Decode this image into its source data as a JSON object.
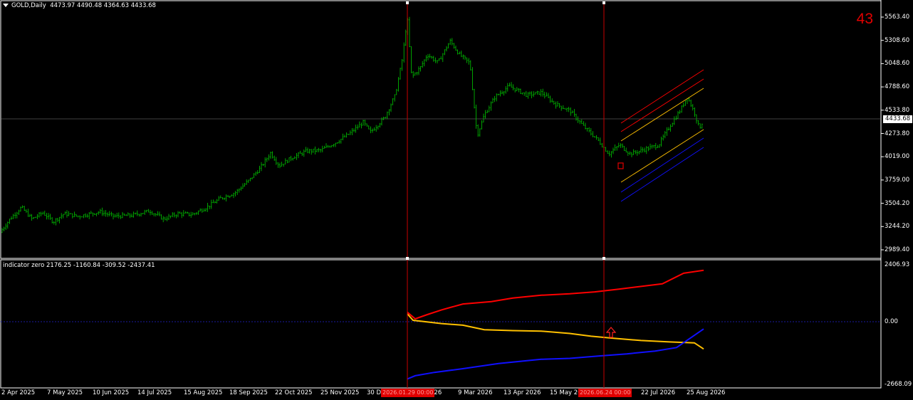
{
  "header": {
    "symbol": "GOLD,Daily",
    "ohlc": "4473.97 4490.48 4364.63 4433.68",
    "counter": "43"
  },
  "current_price": "4433.68",
  "price_axis": [
    "5563.40",
    "5308.60",
    "5048.60",
    "4788.60",
    "4533.80",
    "4273.80",
    "4019.00",
    "3759.00",
    "3504.20",
    "3244.20",
    "2989.40"
  ],
  "indicator": {
    "title": "indicator zero 2176.25 -1160.84 -309.52 -2437.41",
    "axis": [
      "2406.93",
      "0.00",
      "-2668.09"
    ]
  },
  "time_axis": [
    "2 Apr 2025",
    "7 May 2025",
    "10 Jun 2025",
    "14 Jul 2025",
    "15 Aug 2025",
    "18 Sep 2025",
    "22 Oct 2025",
    "25 Nov 2025",
    "30 De",
    "026",
    "9 Mar 2026",
    "13 Apr 2026",
    "15 May 20",
    "22 Jul 2026",
    "25 Aug 2026"
  ],
  "vline_markers": [
    "2026.01.29 00:00",
    "2026.06.24 00:00"
  ],
  "colors": {
    "candle": "#00c800",
    "vline": "#c80000",
    "red_line": "#ff0000",
    "yellow_line": "#ffc000",
    "blue_line": "#1010ff",
    "hline": "#808080"
  },
  "chart_data": [
    {
      "type": "candlestick",
      "title": "GOLD,Daily",
      "x_range": [
        "2 Apr 2025",
        "25 Aug 2026"
      ],
      "ylim": [
        2900,
        5600
      ],
      "close_path": [
        [
          0,
          3180
        ],
        [
          14,
          3330
        ],
        [
          30,
          3460
        ],
        [
          45,
          3330
        ],
        [
          60,
          3400
        ],
        [
          75,
          3300
        ],
        [
          90,
          3390
        ],
        [
          110,
          3360
        ],
        [
          140,
          3410
        ],
        [
          160,
          3360
        ],
        [
          185,
          3370
        ],
        [
          210,
          3420
        ],
        [
          230,
          3330
        ],
        [
          250,
          3390
        ],
        [
          270,
          3380
        ],
        [
          290,
          3460
        ],
        [
          310,
          3560
        ],
        [
          330,
          3620
        ],
        [
          350,
          3760
        ],
        [
          365,
          3890
        ],
        [
          380,
          4060
        ],
        [
          392,
          3920
        ],
        [
          410,
          4010
        ],
        [
          430,
          4080
        ],
        [
          450,
          4090
        ],
        [
          470,
          4170
        ],
        [
          490,
          4270
        ],
        [
          510,
          4400
        ],
        [
          520,
          4290
        ],
        [
          540,
          4450
        ],
        [
          555,
          4700
        ],
        [
          565,
          5100
        ],
        [
          572,
          5560
        ],
        [
          578,
          4900
        ],
        [
          590,
          5000
        ],
        [
          600,
          5150
        ],
        [
          615,
          5060
        ],
        [
          632,
          5300
        ],
        [
          645,
          5150
        ],
        [
          660,
          5050
        ],
        [
          670,
          4250
        ],
        [
          680,
          4480
        ],
        [
          695,
          4680
        ],
        [
          715,
          4800
        ],
        [
          740,
          4700
        ],
        [
          760,
          4730
        ],
        [
          780,
          4600
        ],
        [
          800,
          4530
        ],
        [
          820,
          4350
        ],
        [
          840,
          4200
        ],
        [
          855,
          4050
        ],
        [
          870,
          4150
        ],
        [
          885,
          4050
        ],
        [
          905,
          4100
        ],
        [
          925,
          4150
        ],
        [
          940,
          4350
        ],
        [
          955,
          4530
        ],
        [
          965,
          4680
        ],
        [
          975,
          4510
        ],
        [
          982,
          4330
        ],
        [
          988,
          4430
        ]
      ]
    },
    {
      "type": "line",
      "title": "indicator zero 2176.25 -1160.84 -309.52 -2437.41",
      "ylim": [
        -2668.09,
        2406.93
      ],
      "series": [
        {
          "name": "",
          "color": "red_line",
          "points": [
            [
              572,
              400
            ],
            [
              583,
              120
            ],
            [
              600,
              300
            ],
            [
              620,
              500
            ],
            [
              650,
              750
            ],
            [
              690,
              850
            ],
            [
              720,
              1000
            ],
            [
              760,
              1120
            ],
            [
              800,
              1180
            ],
            [
              835,
              1260
            ],
            [
              870,
              1380
            ],
            [
              930,
              1600
            ],
            [
              960,
              2050
            ],
            [
              988,
              2176.25
            ]
          ]
        },
        {
          "name": "",
          "color": "yellow_line",
          "points": [
            [
              572,
              330
            ],
            [
              580,
              60
            ],
            [
              620,
              -80
            ],
            [
              650,
              -150
            ],
            [
              680,
              -340
            ],
            [
              720,
              -380
            ],
            [
              760,
              -400
            ],
            [
              800,
              -500
            ],
            [
              830,
              -620
            ],
            [
              860,
              -700
            ],
            [
              900,
              -800
            ],
            [
              940,
              -860
            ],
            [
              975,
              -900
            ],
            [
              988,
              -1160.84
            ]
          ]
        },
        {
          "name": "",
          "color": "blue_line",
          "points": [
            [
              572,
              -2437.41
            ],
            [
              583,
              -2300
            ],
            [
              610,
              -2160
            ],
            [
              650,
              -2000
            ],
            [
              700,
              -1780
            ],
            [
              760,
              -1600
            ],
            [
              800,
              -1560
            ],
            [
              840,
              -1460
            ],
            [
              880,
              -1370
            ],
            [
              920,
              -1250
            ],
            [
              950,
              -1100
            ],
            [
              988,
              -309.52
            ]
          ]
        }
      ]
    }
  ]
}
